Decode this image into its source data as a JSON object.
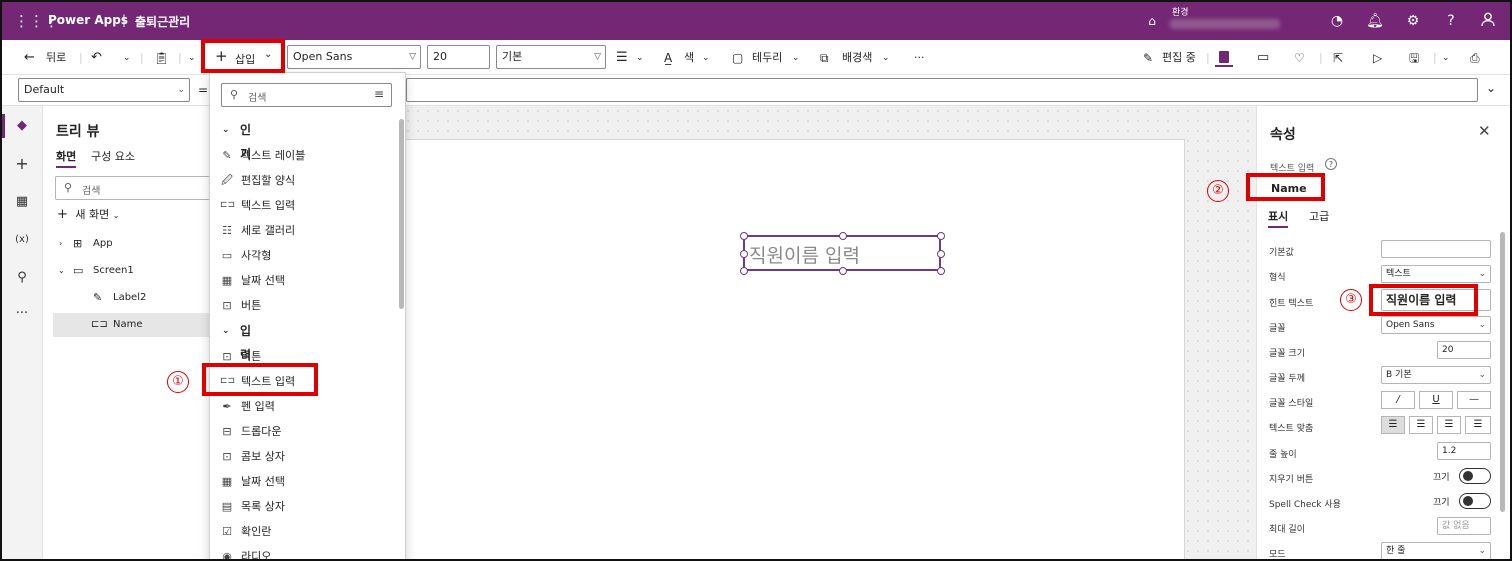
{
  "header": {
    "app_name": "Power Apps",
    "separator": "|",
    "document_title": "출퇴근관리",
    "env_label": "환경"
  },
  "toolbar": {
    "back_label": "뒤로",
    "insert_label": "삽입",
    "font_value": "Open Sans",
    "font_size_value": "20",
    "font_weight_value": "기본",
    "color_label": "색",
    "border_label": "테두리",
    "fill_label": "배경색",
    "more_label": "···",
    "edit_label": "편집 중"
  },
  "formula_bar": {
    "property_value": "Default",
    "equals": "="
  },
  "tree": {
    "title": "트리 뷰",
    "tabs": [
      "화면",
      "구성 요소"
    ],
    "search_placeholder": "검색",
    "new_screen_label": "새 화면",
    "items": [
      {
        "label": "App"
      },
      {
        "label": "Screen1"
      },
      {
        "label": "Label2"
      },
      {
        "label": "Name"
      }
    ]
  },
  "insert_menu": {
    "search_placeholder": "검색",
    "sections": [
      {
        "title": "인기",
        "items": [
          {
            "label": "텍스트 레이블",
            "icon": "edit-label-icon"
          },
          {
            "label": "편집할 양식",
            "icon": "form-icon"
          },
          {
            "label": "텍스트 입력",
            "icon": "text-input-icon"
          },
          {
            "label": "세로 갤러리",
            "icon": "gallery-icon"
          },
          {
            "label": "사각형",
            "icon": "rectangle-icon"
          },
          {
            "label": "날짜 선택",
            "icon": "calendar-icon"
          },
          {
            "label": "버튼",
            "icon": "button-icon"
          }
        ]
      },
      {
        "title": "입력",
        "items": [
          {
            "label": "버튼",
            "icon": "button-icon"
          },
          {
            "label": "텍스트 입력",
            "icon": "text-input-icon"
          },
          {
            "label": "펜 입력",
            "icon": "pen-icon"
          },
          {
            "label": "드롭다운",
            "icon": "dropdown-icon"
          },
          {
            "label": "콤보 상자",
            "icon": "combo-icon"
          },
          {
            "label": "날짜 선택",
            "icon": "calendar-icon"
          },
          {
            "label": "목록 상자",
            "icon": "listbox-icon"
          },
          {
            "label": "확인란",
            "icon": "checkbox-icon"
          },
          {
            "label": "라디오",
            "icon": "radio-icon"
          }
        ]
      }
    ]
  },
  "canvas": {
    "text_input_hint": "직원이름 입력"
  },
  "properties": {
    "title": "속성",
    "control_type": "텍스트 입력",
    "control_name": "Name",
    "tabs": [
      "표시",
      "고급"
    ],
    "rows": [
      {
        "label": "기본값",
        "value": ""
      },
      {
        "label": "형식",
        "value": "텍스트"
      },
      {
        "label": "힌트 텍스트",
        "value": "직원이름 입력"
      },
      {
        "label": "글꼴",
        "value": "Open Sans"
      },
      {
        "label": "글꼴 크기",
        "value": "20"
      },
      {
        "label": "글꼴 두께",
        "value": "B 기본"
      },
      {
        "label": "글꼴 스타일",
        "value": ""
      },
      {
        "label": "텍스트 맞춤",
        "value": ""
      },
      {
        "label": "줄 높이",
        "value": "1.2"
      },
      {
        "label": "지우기 버튼",
        "value": "끄기"
      },
      {
        "label": "Spell Check 사용",
        "value": "끄기"
      },
      {
        "label": "최대 길이",
        "value": "값 없음"
      },
      {
        "label": "모드",
        "value": "한 줄"
      }
    ],
    "font_style_buttons": [
      "/",
      "U",
      "—"
    ]
  },
  "annotations": {
    "step1": "①",
    "step2": "②",
    "step3": "③"
  },
  "colors": {
    "brand": "#742774",
    "highlight": "#e00000",
    "selection_frame": "#6b3a8a"
  }
}
